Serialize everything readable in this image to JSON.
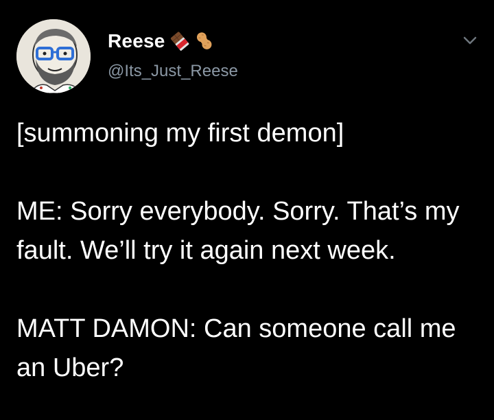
{
  "user": {
    "display_name": "Reese",
    "handle": "@Its_Just_Reese",
    "badge_icons": [
      "chocolate-bar-icon",
      "peanut-icon"
    ]
  },
  "menu": {
    "icon": "chevron-down-icon"
  },
  "tweet": {
    "paragraphs": [
      "[summoning my first demon]",
      "ME: Sorry everybody. Sorry. That’s my fault. We’ll try it again next week.",
      "MATT DAMON: Can someone call me an Uber?"
    ]
  },
  "colors": {
    "background": "#000000",
    "text": "#ffffff",
    "secondary_text": "#8b98a5"
  }
}
